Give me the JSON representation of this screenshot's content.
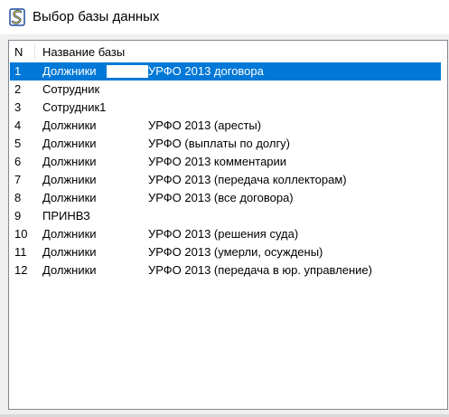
{
  "window": {
    "title": "Выбор базы данных",
    "icon": "database-app-icon"
  },
  "list": {
    "columns": [
      "N",
      "Название базы"
    ],
    "selected_index": 0,
    "rows": [
      {
        "n": "1",
        "name": "Должники",
        "suffix": "УРФО 2013 договора"
      },
      {
        "n": "2",
        "name": "Сотрудник",
        "suffix": ""
      },
      {
        "n": "3",
        "name": "Сотрудник1",
        "suffix": ""
      },
      {
        "n": "4",
        "name": "Должники",
        "suffix": "УРФО 2013 (аресты)"
      },
      {
        "n": "5",
        "name": "Должники",
        "suffix": "УРФО (выплаты по долгу)"
      },
      {
        "n": "6",
        "name": "Должники",
        "suffix": "УРФО 2013 комментарии"
      },
      {
        "n": "7",
        "name": "Должники",
        "suffix": "УРФО 2013 (передача коллекторам)"
      },
      {
        "n": "8",
        "name": "Должники",
        "suffix": "УРФО 2013 (все договора)"
      },
      {
        "n": "9",
        "name": "ПРИНВЗ",
        "suffix": ""
      },
      {
        "n": "10",
        "name": "Должники",
        "suffix": "УРФО 2013 (решения суда)"
      },
      {
        "n": "11",
        "name": "Должники",
        "suffix": "УРФО 2013 (умерли, осуждены)"
      },
      {
        "n": "12",
        "name": "Должники",
        "suffix": "УРФО 2013 (передача в юр. управление)"
      }
    ]
  },
  "colors": {
    "selection": "#0078d7",
    "border": "#828790",
    "window_bg": "#f0f0f0"
  }
}
